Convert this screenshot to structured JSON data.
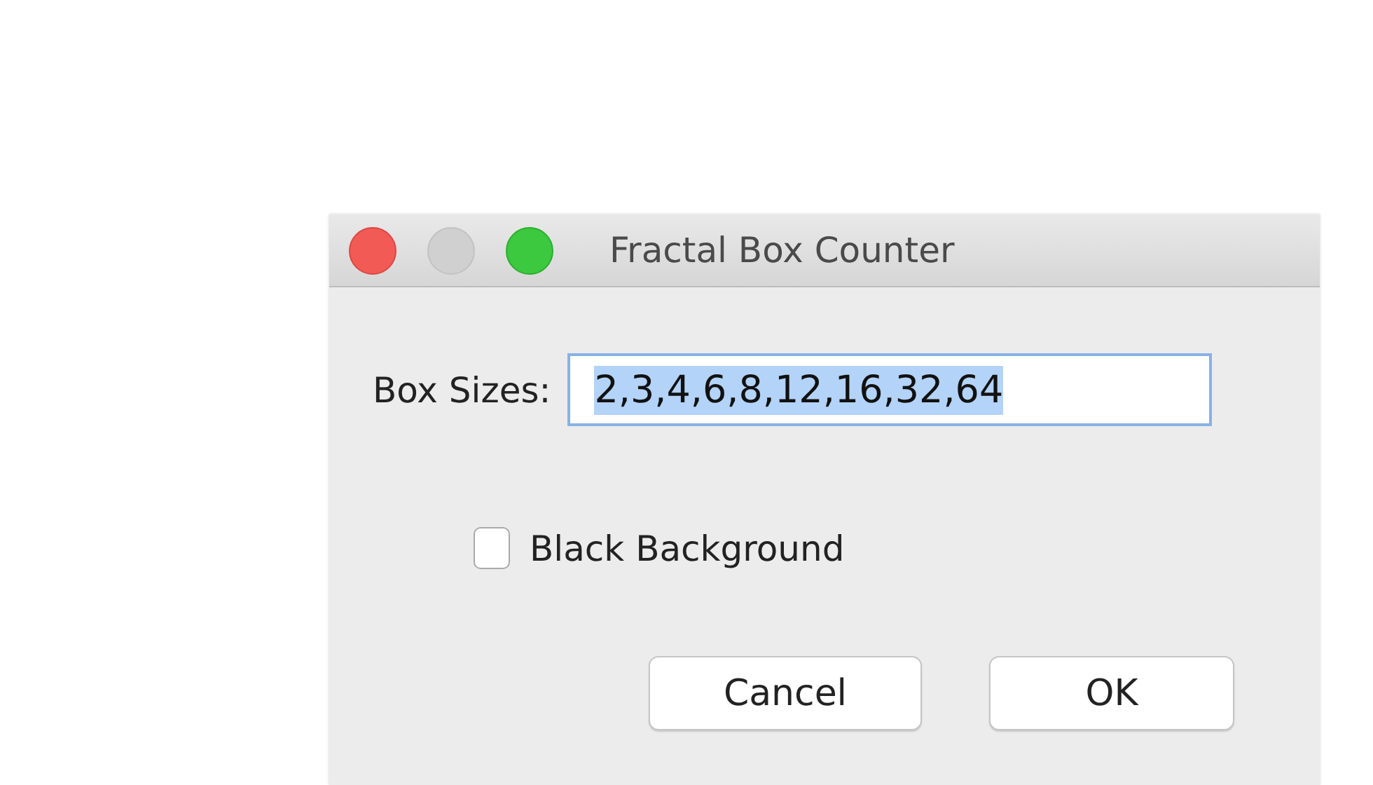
{
  "window": {
    "title": "Fractal Box Counter"
  },
  "box_sizes": {
    "label": "Box Sizes:",
    "value": "2,3,4,6,8,12,16,32,64",
    "text_selected": true
  },
  "black_background": {
    "label": "Black Background",
    "checked": false
  },
  "buttons": [
    {
      "label": "Cancel",
      "default": false
    },
    {
      "label": "OK",
      "default": false
    }
  ]
}
